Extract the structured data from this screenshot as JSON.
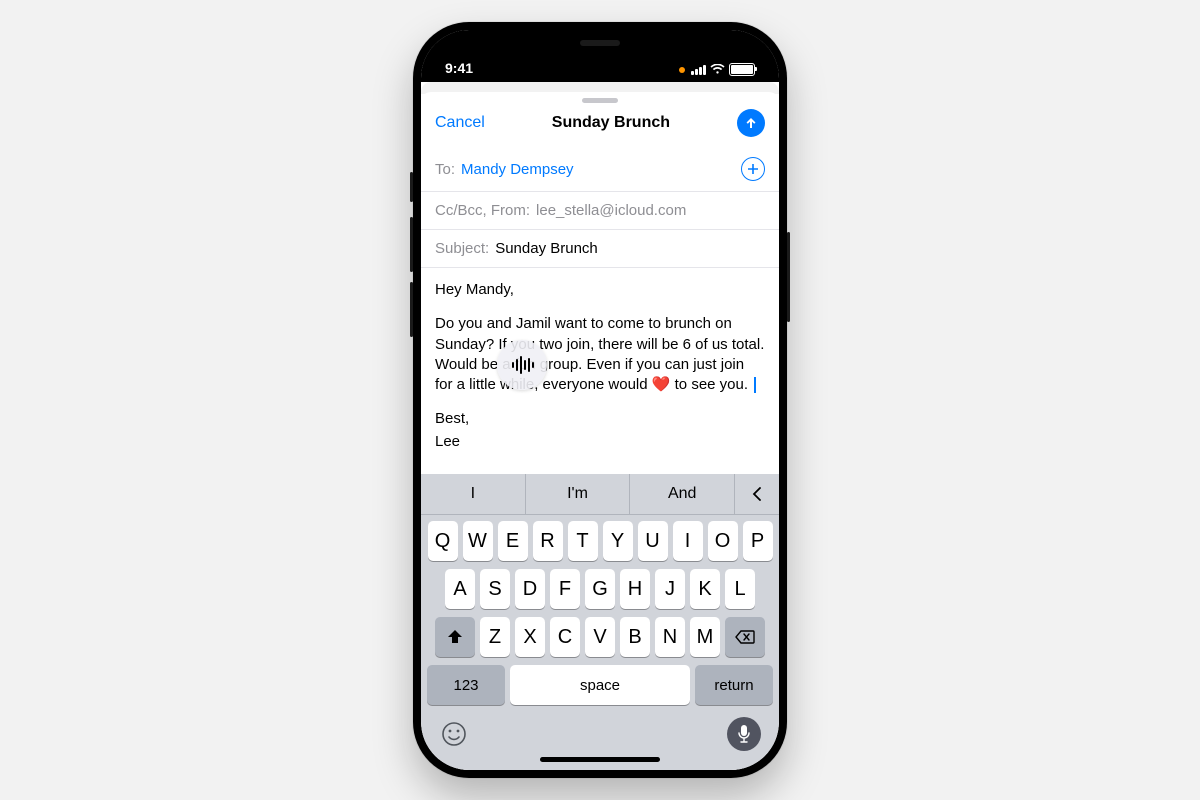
{
  "status": {
    "time": "9:41"
  },
  "nav": {
    "cancel": "Cancel",
    "title": "Sunday Brunch"
  },
  "fields": {
    "to_label": "To:",
    "to_value": "Mandy Dempsey",
    "cc_label": "Cc/Bcc, From:",
    "cc_value": "lee_stella@icloud.com",
    "subject_label": "Subject:",
    "subject_value": "Sunday Brunch"
  },
  "body": {
    "greeting": "Hey Mandy,",
    "para1a": "Do you and Jamil want to come to brunch on Sunday? If you two join, there will be 6 of us total. Would be a fun group. Even if you can just join for a little while, everyone would ",
    "para1b": " to see you. ",
    "closing": "Best,",
    "signature": "Lee"
  },
  "suggestions": {
    "s1": "I",
    "s2": "I'm",
    "s3": "And"
  },
  "keys": {
    "r1": [
      "Q",
      "W",
      "E",
      "R",
      "T",
      "Y",
      "U",
      "I",
      "O",
      "P"
    ],
    "r2": [
      "A",
      "S",
      "D",
      "F",
      "G",
      "H",
      "J",
      "K",
      "L"
    ],
    "r3": [
      "Z",
      "X",
      "C",
      "V",
      "B",
      "N",
      "M"
    ],
    "k123": "123",
    "space": "space",
    "return": "return"
  }
}
